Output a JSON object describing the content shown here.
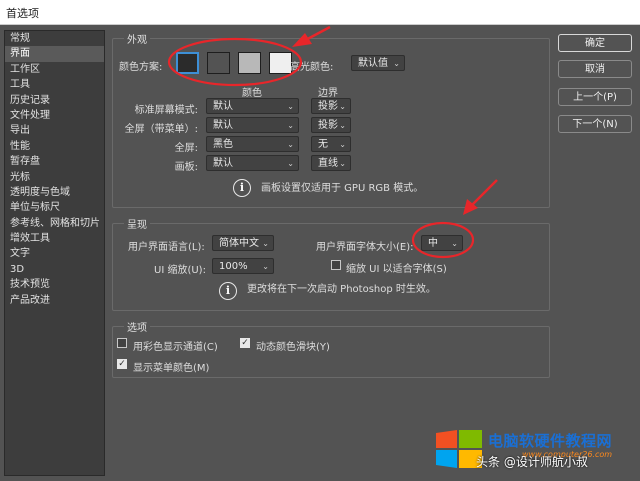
{
  "window": {
    "title": "首选项"
  },
  "sidebar": {
    "items": [
      "常规",
      "界面",
      "工作区",
      "工具",
      "历史记录",
      "文件处理",
      "导出",
      "性能",
      "暂存盘",
      "光标",
      "透明度与色域",
      "单位与标尺",
      "参考线、网格和切片",
      "增效工具",
      "文字",
      "3D",
      "技术预览",
      "产品改进"
    ],
    "active_index": 1
  },
  "appearance": {
    "legend": "外观",
    "color_scheme_label": "颜色方案:",
    "color_schemes": [
      "#2b2b2b",
      "#535353",
      "#b8b8b8",
      "#efefef"
    ],
    "selected_scheme_index": 0,
    "highlight_label": "高光颜色:",
    "highlight_value": "默认值",
    "col_color": "颜色",
    "col_border": "边界",
    "rows": [
      {
        "label": "标准屏幕模式:",
        "color": "默认",
        "border": "投影"
      },
      {
        "label": "全屏（带菜单）:",
        "color": "默认",
        "border": "投影"
      },
      {
        "label": "全屏:",
        "color": "黑色",
        "border": "无"
      },
      {
        "label": "画板:",
        "color": "默认",
        "border": "直线"
      }
    ],
    "note": "画板设置仅适用于 GPU RGB 模式。"
  },
  "presentation": {
    "legend": "呈现",
    "ui_language_label": "用户界面语言(L):",
    "ui_language_value": "简体中文",
    "ui_font_size_label": "用户界面字体大小(E):",
    "ui_font_size_value": "中",
    "ui_scale_label": "UI 缩放(U):",
    "ui_scale_value": "100%",
    "scale_to_font_label": "缩放 UI 以适合字体(S)",
    "scale_to_font_checked": false,
    "note": "更改将在下一次启动 Photoshop 时生效。"
  },
  "options": {
    "legend": "选项",
    "items": [
      {
        "label": "用彩色显示通道(C)",
        "checked": false
      },
      {
        "label": "动态颜色滑块(Y)",
        "checked": true
      },
      {
        "label": "显示菜单颜色(M)",
        "checked": true
      }
    ]
  },
  "buttons": {
    "ok": "确定",
    "cancel": "取消",
    "prev": "上一个(P)",
    "next": "下一个(N)"
  },
  "watermark": {
    "title": "电脑软硬件教程网",
    "url": "www.computer26.com",
    "signature": "头条 @设计师航小叔"
  },
  "colors": {
    "annotation_red": "#e8262a",
    "accent_blue": "#1a6fd4"
  }
}
